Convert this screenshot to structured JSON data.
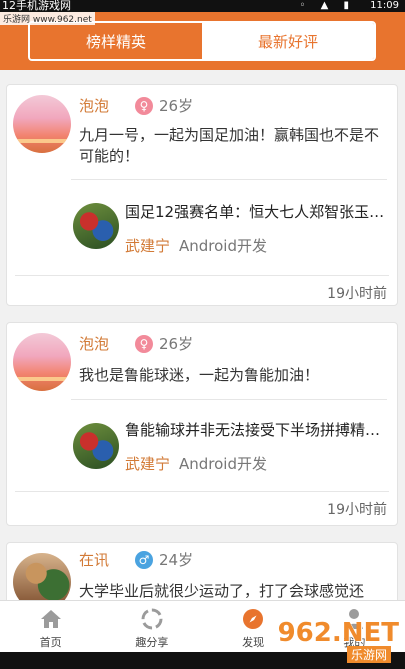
{
  "status": {
    "watermark_top": "12手机游戏网",
    "time": "11:09"
  },
  "watermark_sub": "乐游网 www.962.net",
  "tabs": [
    {
      "label": "榜样精英"
    },
    {
      "label": "最新好评"
    }
  ],
  "posts": [
    {
      "user": "泡泡",
      "gender": "♀",
      "age": "26岁",
      "text": "九月一号，一起为国足加油！赢韩国也不是不可能的！",
      "ref_title": "国足12强赛名单：恒大七人郑智张玉宁…",
      "ref_author": "武建宁",
      "ref_role": "Android开发",
      "time": "19小时前"
    },
    {
      "user": "泡泡",
      "gender": "♀",
      "age": "26岁",
      "text": "我也是鲁能球迷，一起为鲁能加油！",
      "ref_title": "鲁能输球并非无法接受下半场拼搏精神…",
      "ref_author": "武建宁",
      "ref_role": "Android开发",
      "time": "19小时前"
    },
    {
      "user": "在讯",
      "gender": "♂",
      "age": "24岁",
      "text": "大学毕业后就很少运动了，打了会球感觉还"
    }
  ],
  "nav": [
    {
      "label": "首页",
      "icon": "home-icon"
    },
    {
      "label": "趣分享",
      "icon": "share-icon"
    },
    {
      "label": "发现",
      "icon": "compass-icon"
    },
    {
      "label": "我的",
      "icon": "user-icon"
    }
  ],
  "watermark_logo": "962.NET",
  "watermark_logo_sub": "乐游网",
  "colors": {
    "accent": "#e8742e",
    "username": "#d27a36"
  }
}
